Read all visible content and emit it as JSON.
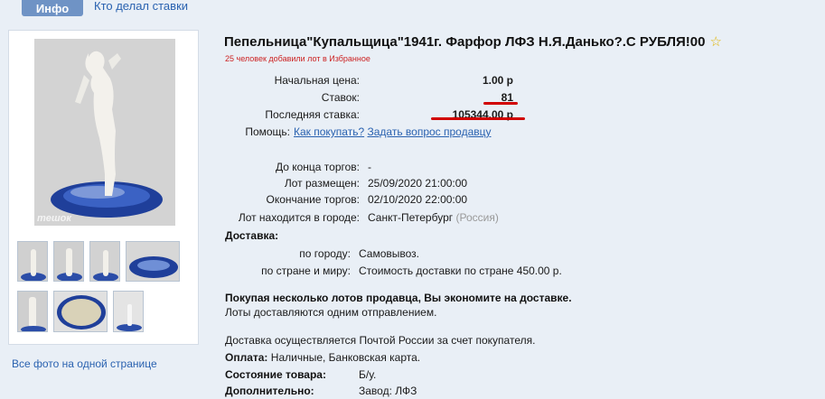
{
  "tabs": {
    "info": "Инфо",
    "bidders": "Кто делал ставки"
  },
  "lot": {
    "title": "Пепельница\"Купальщица\"1941г. Фарфор ЛФЗ Н.Я.Данько?.С РУБЛЯ!00",
    "star": "☆",
    "favorites": "25 человек добавили лот в Избранное"
  },
  "bids": {
    "start_label": "Начальная цена:",
    "start_value": "1.00 р",
    "count_label": "Ставок:",
    "count_value": "81",
    "last_label": "Последняя ставка:",
    "last_value": "105344.00 р",
    "help_label": "Помощь:",
    "help_link1": "Как покупать?",
    "help_link2": "Задать вопрос продавцу"
  },
  "timing": {
    "remain_label": "До конца торгов:",
    "remain_value": "-",
    "placed_label": "Лот размещен:",
    "placed_value": "25/09/2020 21:00:00",
    "end_label": "Окончание торгов:",
    "end_value": "02/10/2020 22:00:00",
    "city_label": "Лот находится в городе:",
    "city_value": "Санкт-Петербург",
    "city_region": "(Россия)"
  },
  "delivery": {
    "heading": "Доставка:",
    "city_label": "по городу:",
    "city_value": "Самовывоз.",
    "world_label": "по стране и миру:",
    "world_value": "Стоимость доставки по стране 450.00 р."
  },
  "notes": {
    "save_bold": "Покупая несколько лотов продавца, Вы экономите на доставке.",
    "save_plain": "Лоты доставляются одним отправлением.",
    "post": "Доставка осуществляется Почтой России за счет покупателя.",
    "payment_label": "Оплата:",
    "payment_value": "Наличные, Банковская карта.",
    "state_label": "Состояние товара:",
    "state_value": "Б/у.",
    "extra_label": "Дополнительно:",
    "extra_value": "Завод: ЛФЗ"
  },
  "gallery": {
    "watermark": "meшок",
    "all_photos": "Все фото на одной странице"
  },
  "colors": {
    "accent": "#6f93c5",
    "link": "#2a62b0",
    "highlight": "#d10000",
    "plate": "#1f3f9a"
  }
}
